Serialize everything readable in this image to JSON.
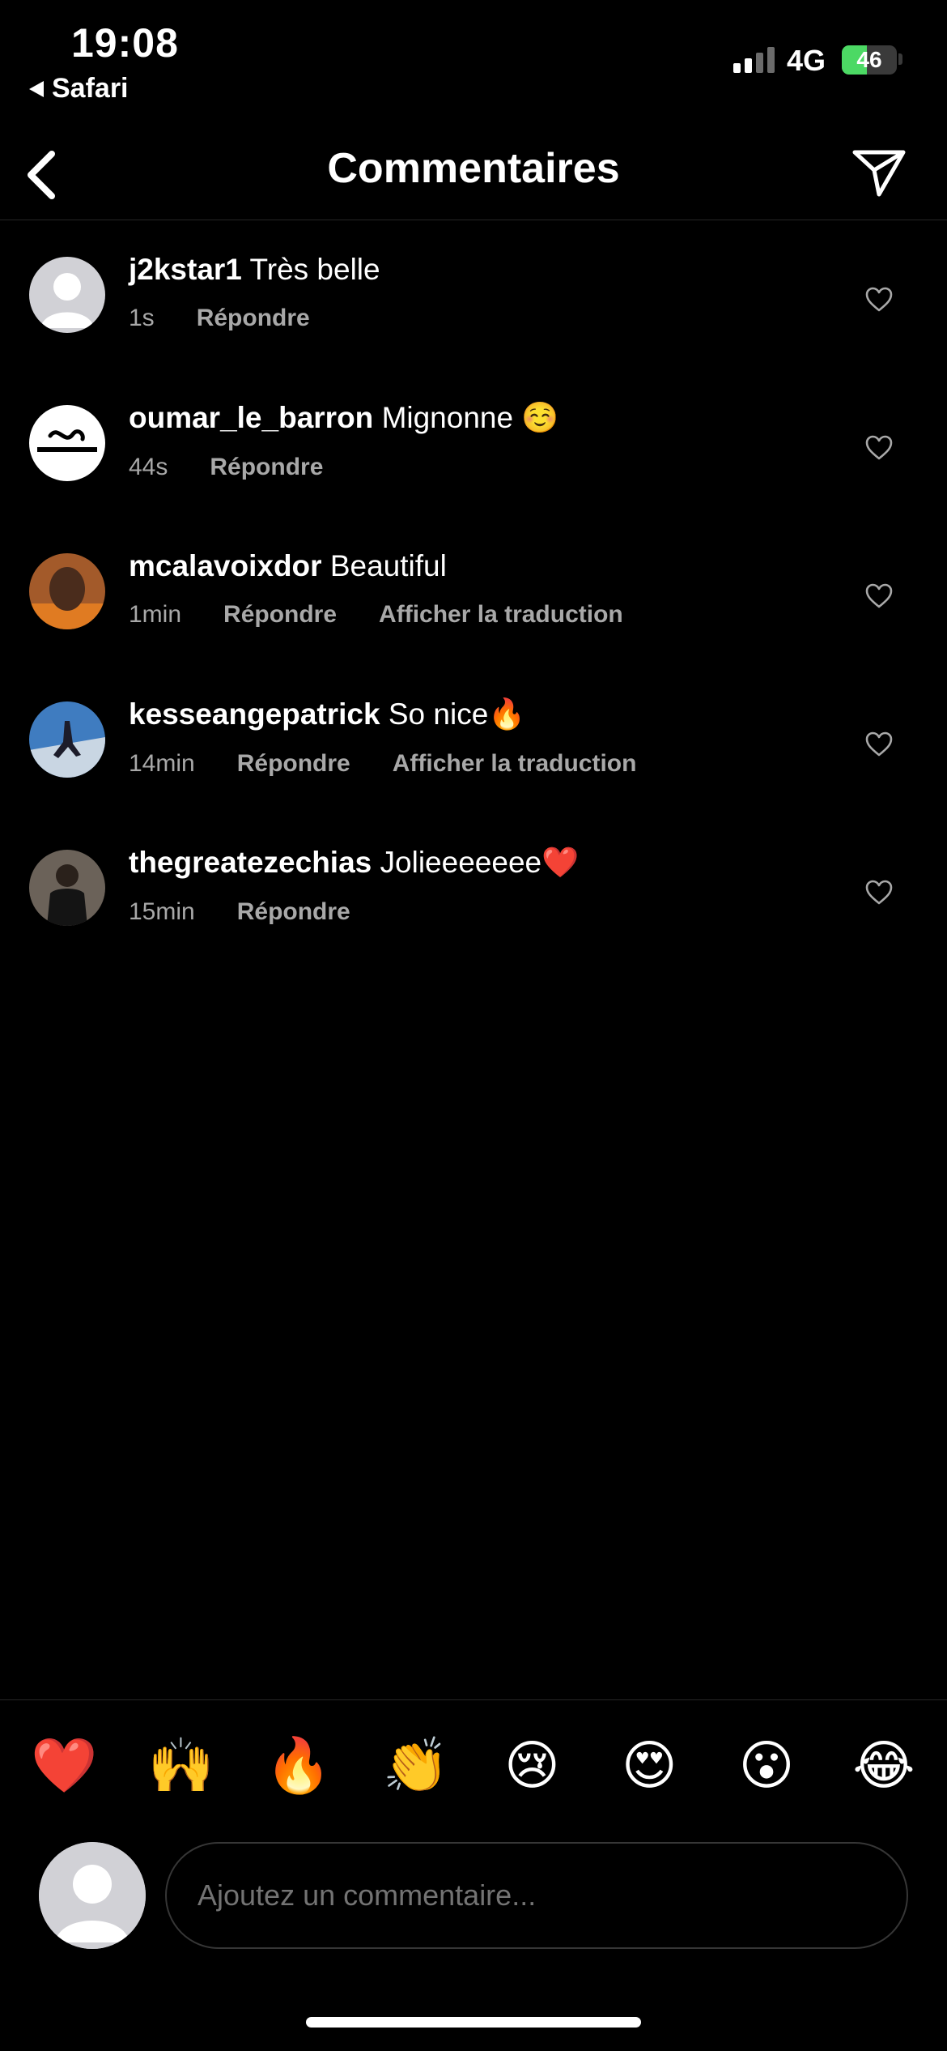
{
  "status_bar": {
    "time": "19:08",
    "back_app": "Safari",
    "network": "4G",
    "battery_level": "46",
    "battery_fraction": 0.46,
    "battery_color": "#4cd964"
  },
  "header": {
    "title": "Commentaires",
    "back_icon": "chevron-left-icon",
    "send_icon": "paper-plane-icon"
  },
  "comments": [
    {
      "username": "j2kstar1",
      "text": "Très belle",
      "time": "1s",
      "reply_label": "Répondre",
      "translate_label": ""
    },
    {
      "username": "oumar_le_barron",
      "text": "Mignonne ☺️",
      "time": "44s",
      "reply_label": "Répondre",
      "translate_label": ""
    },
    {
      "username": "mcalavoixdor",
      "text": "Beautiful",
      "time": "1min",
      "reply_label": "Répondre",
      "translate_label": "Afficher la traduction"
    },
    {
      "username": "kesseangepatrick",
      "text": "So nice🔥",
      "time": "14min",
      "reply_label": "Répondre",
      "translate_label": "Afficher la traduction"
    },
    {
      "username": "thegreatezechias",
      "text": "Jolieeeeeee❤️",
      "time": "15min",
      "reply_label": "Répondre",
      "translate_label": ""
    }
  ],
  "emoji_bar": [
    "❤️",
    "🙌",
    "🔥",
    "👏",
    "😢",
    "😍",
    "😮",
    "😂"
  ],
  "composer": {
    "placeholder": "Ajoutez un commentaire..."
  }
}
